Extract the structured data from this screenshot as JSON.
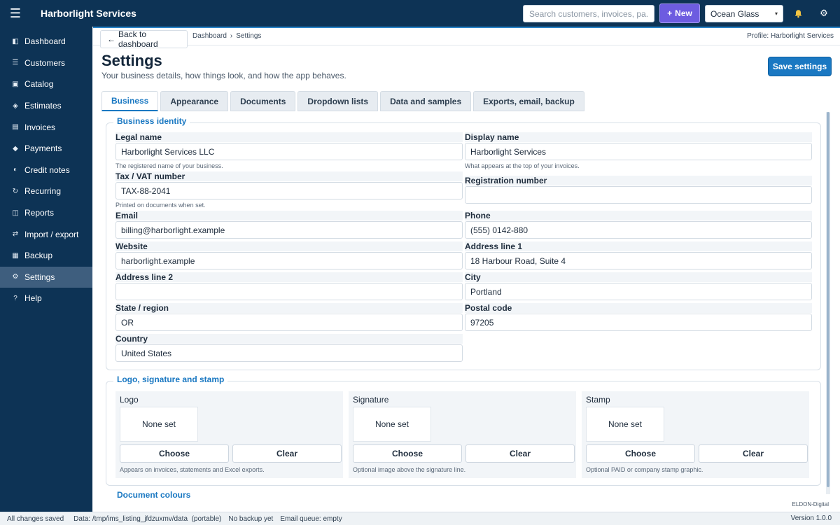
{
  "app": {
    "title": "Harborlight Services"
  },
  "topbar": {
    "search_placeholder": "Search customers, invoices, pa...",
    "new_label": "New",
    "theme_value": "Ocean Glass"
  },
  "sidebar": {
    "items": [
      {
        "label": "Dashboard",
        "icon": "dashboard-icon",
        "glyph": "◧"
      },
      {
        "label": "Customers",
        "icon": "list-icon",
        "glyph": "☰"
      },
      {
        "label": "Catalog",
        "icon": "catalog-icon",
        "glyph": "▣"
      },
      {
        "label": "Estimates",
        "icon": "estimate-icon",
        "glyph": "◈"
      },
      {
        "label": "Invoices",
        "icon": "invoice-icon",
        "glyph": "▤"
      },
      {
        "label": "Payments",
        "icon": "payment-icon",
        "glyph": "◆"
      },
      {
        "label": "Credit notes",
        "icon": "credit-note-icon",
        "glyph": "◐"
      },
      {
        "label": "Recurring",
        "icon": "recurring-icon",
        "glyph": "↻"
      },
      {
        "label": "Reports",
        "icon": "reports-icon",
        "glyph": "◫"
      },
      {
        "label": "Import / export",
        "icon": "import-export-icon",
        "glyph": "⇄"
      },
      {
        "label": "Backup",
        "icon": "backup-icon",
        "glyph": "▦"
      },
      {
        "label": "Settings",
        "icon": "gear-icon",
        "glyph": "⚙"
      },
      {
        "label": "Help",
        "icon": "help-icon",
        "glyph": "?"
      }
    ],
    "active": "Settings"
  },
  "crumbbar": {
    "back_label": "Back to dashboard",
    "crumbs": [
      "Dashboard",
      "Settings"
    ],
    "profile": "Profile: Harborlight Services"
  },
  "page": {
    "title": "Settings",
    "subtitle": "Your business details, how things look, and how the app behaves.",
    "save_label": "Save settings"
  },
  "tabs": [
    "Business",
    "Appearance",
    "Documents",
    "Dropdown lists",
    "Data and samples",
    "Exports, email, backup"
  ],
  "identity": {
    "legend": "Business identity",
    "legal_name": {
      "label": "Legal name",
      "value": "Harborlight Services LLC",
      "help": "The registered name of your business."
    },
    "display_name": {
      "label": "Display name",
      "value": "Harborlight Services",
      "help": "What appears at the top of your invoices."
    },
    "tax": {
      "label": "Tax / VAT number",
      "value": "TAX-88-2041",
      "help": "Printed on documents when set."
    },
    "registration": {
      "label": "Registration number",
      "value": ""
    },
    "email": {
      "label": "Email",
      "value": "billing@harborlight.example"
    },
    "phone": {
      "label": "Phone",
      "value": "(555) 0142-880"
    },
    "website": {
      "label": "Website",
      "value": "harborlight.example"
    },
    "address1": {
      "label": "Address line 1",
      "value": "18 Harbour Road, Suite 4"
    },
    "address2": {
      "label": "Address line 2",
      "value": ""
    },
    "city": {
      "label": "City",
      "value": "Portland"
    },
    "state": {
      "label": "State / region",
      "value": "OR"
    },
    "postal": {
      "label": "Postal code",
      "value": "97205"
    },
    "country": {
      "label": "Country",
      "value": "United States"
    }
  },
  "assets": {
    "legend": "Logo, signature and stamp",
    "logo": {
      "title": "Logo",
      "preview": "None set",
      "choose": "Choose",
      "clear": "Clear",
      "help": "Appears on invoices, statements and Excel exports."
    },
    "signature": {
      "title": "Signature",
      "preview": "None set",
      "choose": "Choose",
      "clear": "Clear",
      "help": "Optional image above the signature line."
    },
    "stamp": {
      "title": "Stamp",
      "preview": "None set",
      "choose": "Choose",
      "clear": "Clear",
      "help": "Optional PAID or company stamp graphic."
    }
  },
  "next_section": "Document colours",
  "brand": "ELDON-Digital",
  "status": {
    "saved": "All changes saved",
    "data_path": "Data: /tmp/ims_listing_jfdzuxmv/data  (portable)",
    "backup": "No backup yet",
    "email_queue": "Email queue: empty",
    "version": "Version 1.0.0"
  }
}
